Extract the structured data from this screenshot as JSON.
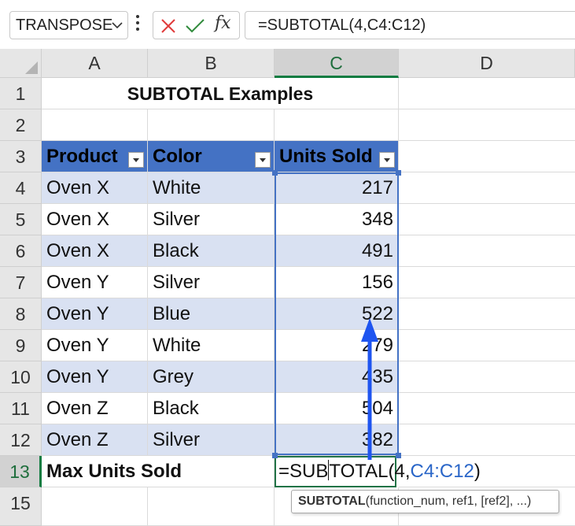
{
  "formula_bar": {
    "name_box": "TRANSPOSE",
    "fx_label": "fx",
    "formula": "=SUBTOTAL(4,C4:C12)"
  },
  "columns": [
    "A",
    "B",
    "C",
    "D"
  ],
  "rows": [
    "1",
    "2",
    "3",
    "4",
    "5",
    "6",
    "7",
    "8",
    "9",
    "10",
    "11",
    "12",
    "13",
    "15"
  ],
  "title": "SUBTOTAL Examples",
  "table": {
    "headers": [
      "Product",
      "Color",
      "Units Sold"
    ],
    "rows": [
      [
        "Oven X",
        "White",
        "217"
      ],
      [
        "Oven X",
        "Silver",
        "348"
      ],
      [
        "Oven X",
        "Black",
        "491"
      ],
      [
        "Oven Y",
        "Silver",
        "156"
      ],
      [
        "Oven Y",
        "Blue",
        "522"
      ],
      [
        "Oven Y",
        "White",
        "279"
      ],
      [
        "Oven Y",
        "Grey",
        "435"
      ],
      [
        "Oven Z",
        "Black",
        "504"
      ],
      [
        "Oven Z",
        "Silver",
        "382"
      ]
    ]
  },
  "summary": {
    "label": "Max Units Sold",
    "edit_part1": "=SUB",
    "edit_part2": "TOTAL(4,",
    "edit_ref": "C4:C12",
    "edit_close": ")"
  },
  "tooltip": {
    "fn": "SUBTOTAL",
    "args": "(function_num, ref1, [ref2], ...)"
  },
  "colors": {
    "header_fill": "#4472c4",
    "band_fill": "#d9e1f2",
    "selection_green": "#107c41",
    "reference_blue": "#2a66c8",
    "arrow_blue": "#1f55f0"
  }
}
